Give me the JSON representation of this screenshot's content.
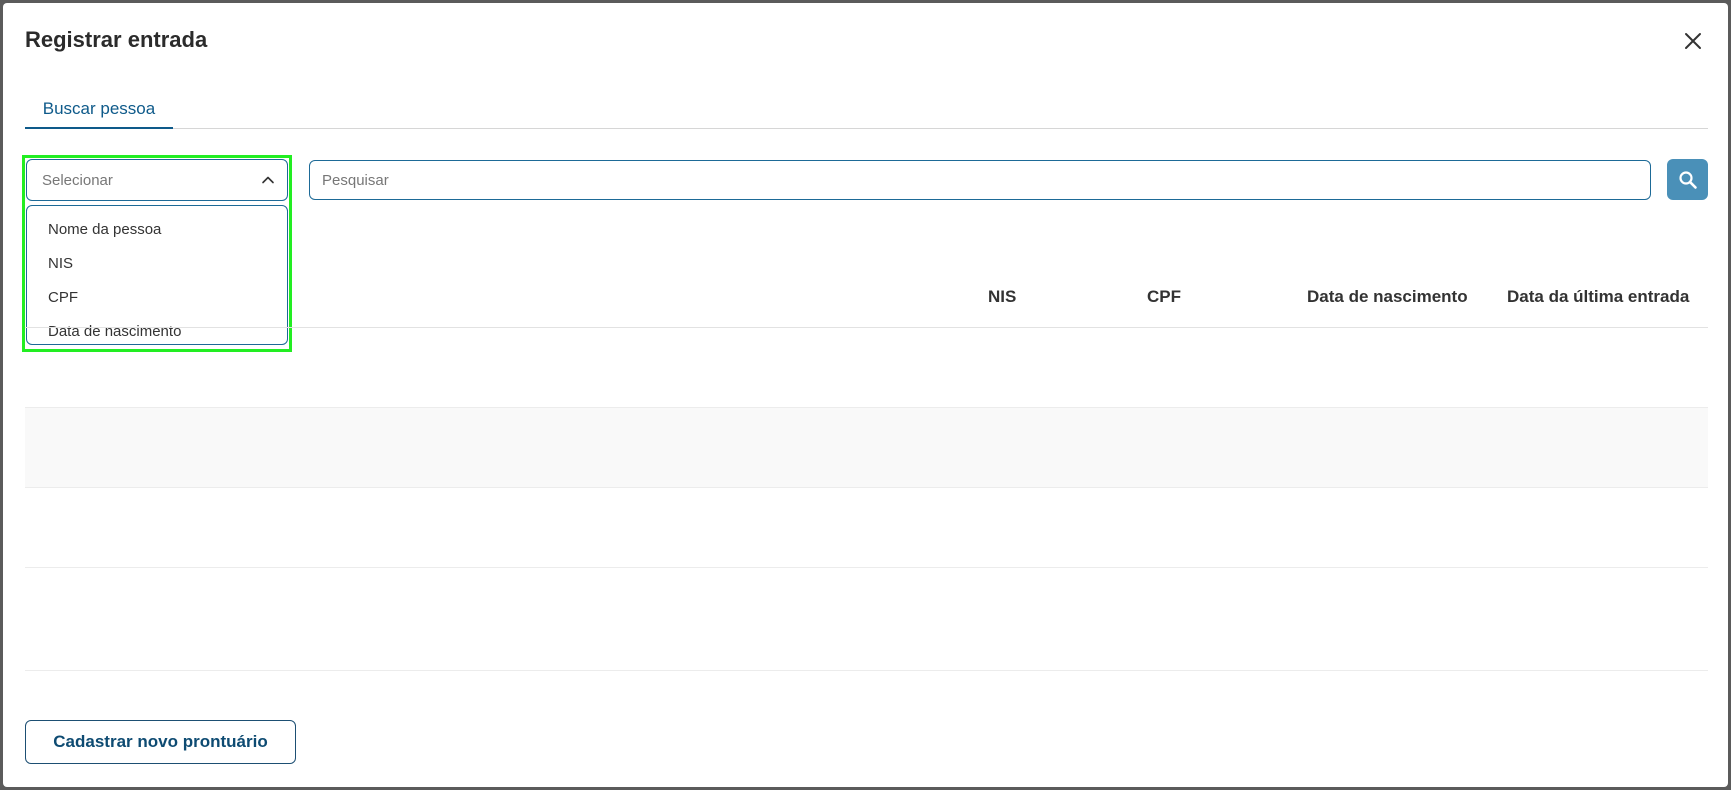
{
  "modal": {
    "title": "Registrar entrada",
    "close_icon": "close-icon"
  },
  "tabs": [
    {
      "label": "Buscar pessoa",
      "active": true
    }
  ],
  "filter": {
    "placeholder": "Selecionar",
    "expanded": true,
    "options": [
      "Nome da pessoa",
      "NIS",
      "CPF",
      "Data de nascimento"
    ]
  },
  "search": {
    "placeholder": "Pesquisar",
    "value": "",
    "icon": "search-icon"
  },
  "table": {
    "columns": [
      "NIS",
      "CPF",
      "Data de nascimento",
      "Data da última entrada"
    ],
    "rows": []
  },
  "footer": {
    "new_record_label": "Cadastrar novo prontuário"
  },
  "colors": {
    "accent": "#0e5a8a",
    "search_button": "#4a90b8",
    "focus_highlight": "#22ee22"
  }
}
